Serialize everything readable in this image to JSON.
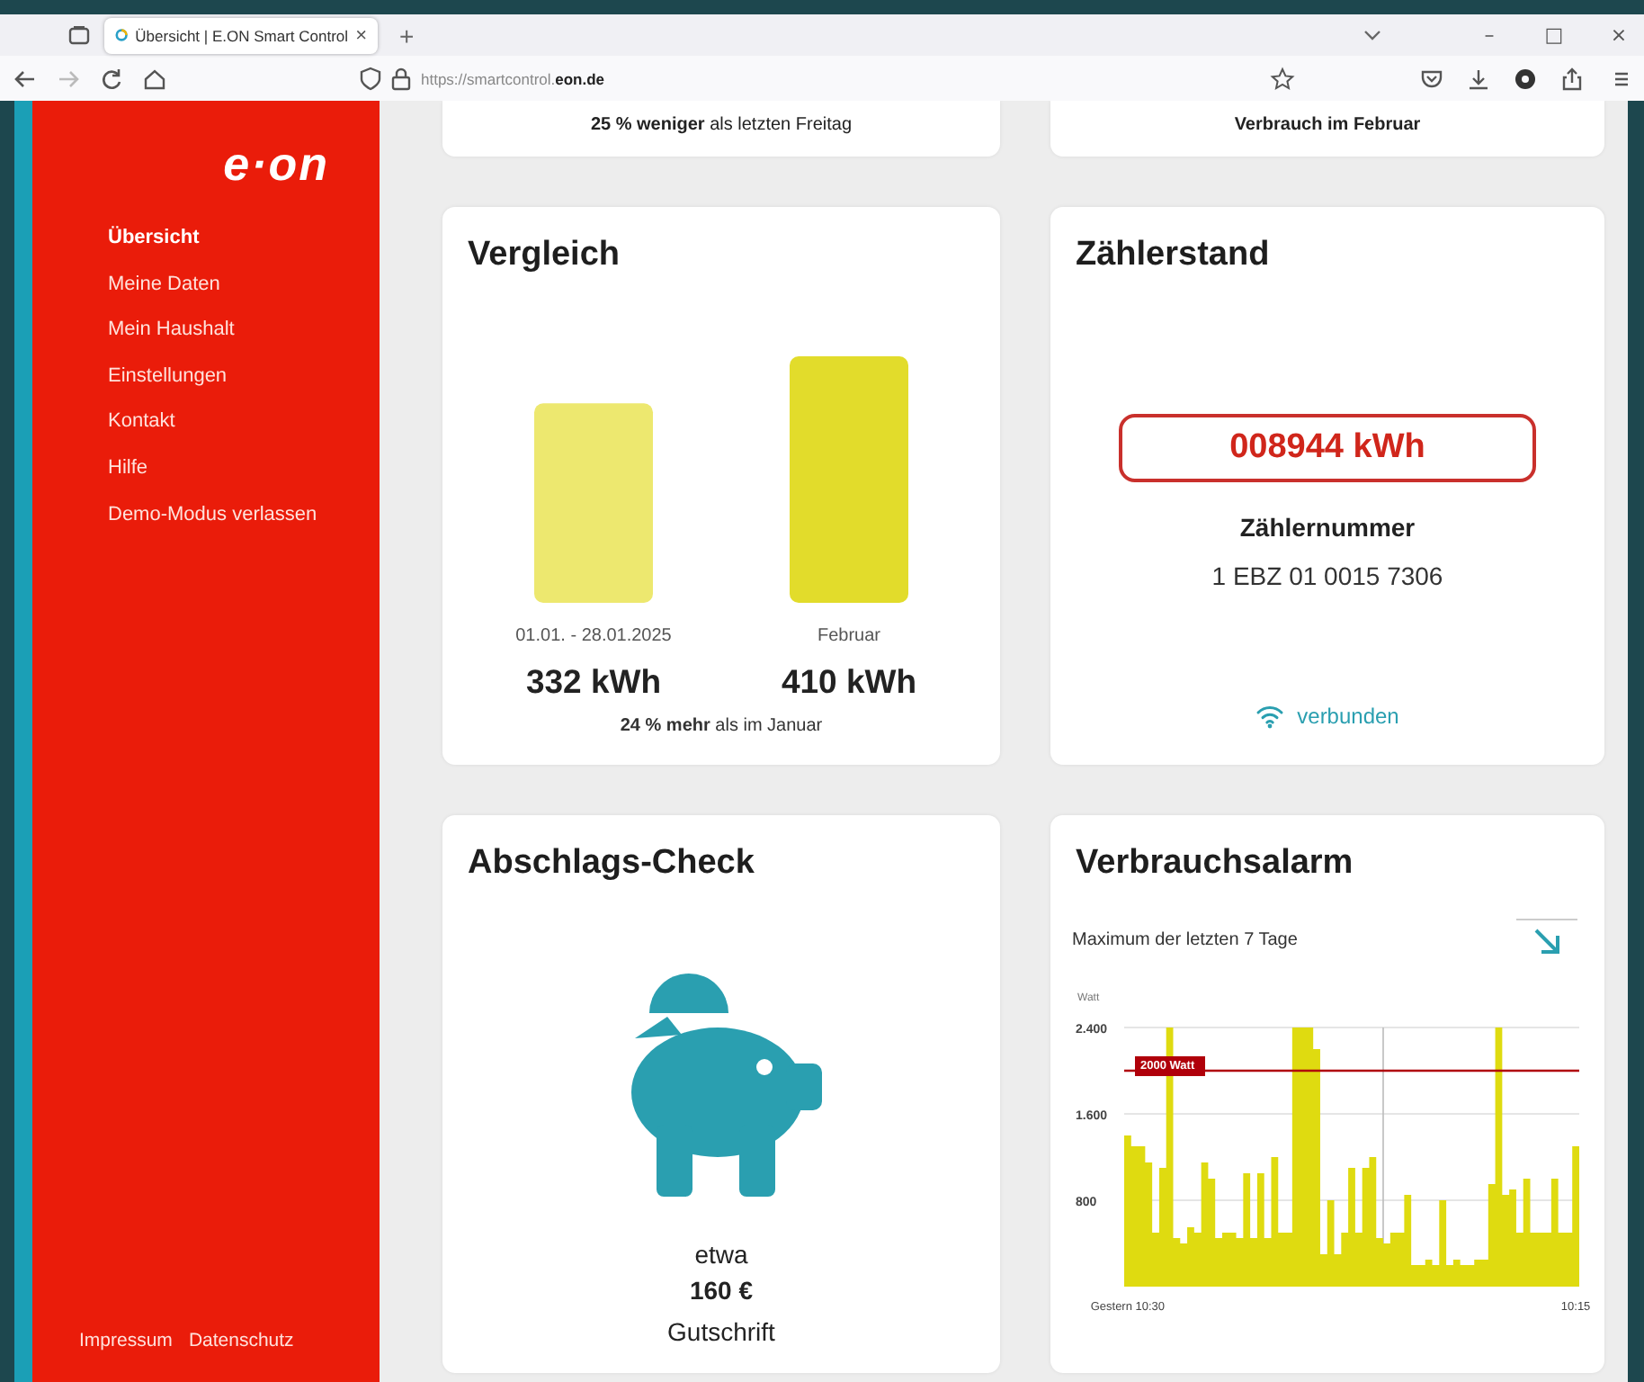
{
  "browser": {
    "tab": {
      "title": "Übersicht | E.ON Smart Control",
      "close": "×",
      "selected": true
    },
    "new_tab": "+",
    "window_controls": [
      "–",
      "□",
      "×"
    ],
    "nav": {
      "back": {
        "disabled": false
      },
      "forward": {
        "disabled": true
      }
    },
    "url": "https://smartcontrol.**eon.de**"
  },
  "sidebar": {
    "logo": "e·on",
    "items": [
      {
        "label": "Übersicht",
        "selected": true
      },
      {
        "label": "Meine Daten",
        "selected": false
      },
      {
        "label": "Mein Haushalt",
        "selected": false
      },
      {
        "label": "Einstellungen",
        "selected": false
      },
      {
        "label": "Kontakt",
        "selected": false
      },
      {
        "label": "Hilfe",
        "selected": false
      },
      {
        "label": "Demo-Modus verlassen",
        "selected": false
      }
    ],
    "footer_links": [
      "Impressum",
      "Datenschutz"
    ]
  },
  "cards": [
    {
      "kind": "partial",
      "text": "**25 % weniger** als letzten Freitag",
      "bold": false
    },
    {
      "kind": "partial",
      "text": "Verbrauch im Februar",
      "bold": true
    },
    {
      "kind": "comparison",
      "title": "Vergleich",
      "chart_data": {
        "type": "bar",
        "categories": [
          "01.01. - 28.01.2025",
          "Februar"
        ],
        "values": [
          332,
          410
        ],
        "value_labels": [
          "332 kWh",
          "410 kWh"
        ]
      },
      "bars": [
        {
          "color": "#ede86f"
        },
        {
          "color": "#e2dc2b"
        }
      ],
      "summary": "**24 % mehr** als im Januar"
    },
    {
      "kind": "meter",
      "title": "Zählerstand",
      "reading": "008944 kWh",
      "label": "Zählernummer",
      "number": "1 EBZ 01 0015 7306",
      "connected": true,
      "status": "verbunden"
    },
    {
      "kind": "advance",
      "title": "Abschlags-Check",
      "prefix": "etwa",
      "amount": "160 €",
      "result": "Gutschrift"
    },
    {
      "kind": "alarm",
      "title": "Verbrauchsalarm",
      "subtitle": "Maximum der letzten 7 Tage",
      "chart_data": {
        "type": "area",
        "ylabel": "Watt",
        "ylim": [
          0,
          2400
        ],
        "yticks": [
          {
            "value": 800,
            "label": "800"
          },
          {
            "value": 1600,
            "label": "1.600"
          },
          {
            "value": 2400,
            "label": "2.400"
          }
        ],
        "categories": [
          "Gestern 10:30",
          null,
          null,
          null,
          null,
          null,
          null,
          null,
          null,
          null,
          null,
          null,
          null,
          null,
          null,
          null,
          null,
          null,
          null,
          null,
          null,
          null,
          null,
          null,
          null,
          null,
          null,
          null,
          null,
          null,
          null,
          null,
          null,
          null,
          null,
          null,
          null,
          null,
          null,
          null,
          null,
          null,
          null,
          null,
          null,
          null,
          null,
          null,
          null,
          null,
          null,
          null,
          null,
          null,
          null,
          null,
          null,
          null,
          null,
          null,
          null,
          null,
          null,
          null,
          "10:15"
        ],
        "series": [
          {
            "color": "#dfdb10",
            "values": [
              1400,
              1300,
              1300,
              1150,
              500,
              1100,
              2400,
              450,
              400,
              550,
              500,
              1150,
              1000,
              450,
              500,
              500,
              450,
              1050,
              450,
              1050,
              450,
              1200,
              500,
              500,
              2400,
              2400,
              2400,
              2200,
              300,
              800,
              300,
              500,
              1100,
              500,
              1100,
              1200,
              450,
              400,
              500,
              500,
              850,
              200,
              200,
              250,
              200,
              800,
              200,
              250,
              200,
              200,
              250,
              250,
              950,
              2400,
              850,
              900,
              500,
              1000,
              500,
              500,
              500,
              1000,
              500,
              500,
              1300
            ]
          }
        ],
        "ref_lines": [
          {
            "axis": "y",
            "value": 2000,
            "label": "2000 Watt",
            "color": "#b0000a"
          }
        ]
      }
    }
  ]
}
